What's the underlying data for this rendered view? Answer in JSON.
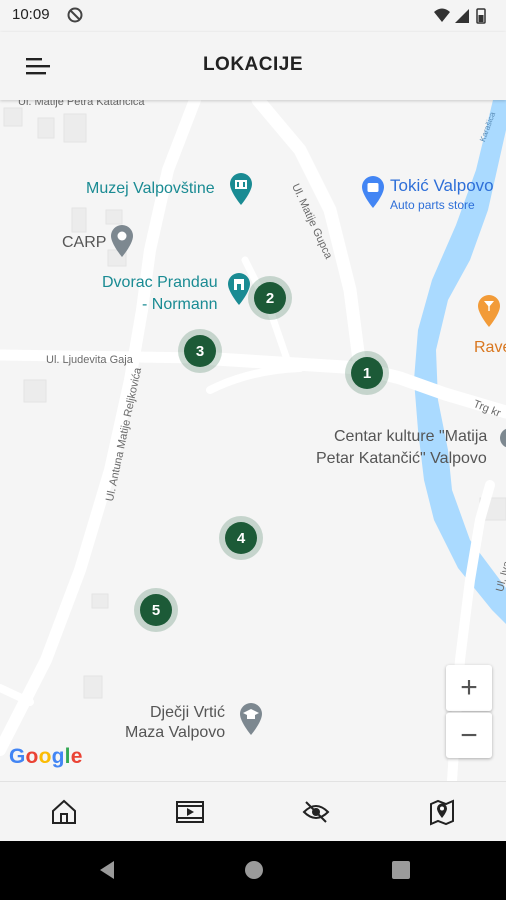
{
  "status_bar": {
    "time": "10:09"
  },
  "app_bar": {
    "title": "LOKACIJE"
  },
  "map": {
    "pois": {
      "museum": "Muzej Valpovštine",
      "carp": "CARP",
      "castle_line1": "Dvorac Prandau",
      "castle_line2": "- Normann",
      "store": "Tokić Valpovo",
      "store_sub": "Auto parts store",
      "rave": "Rave",
      "culture_line1": "Centar kulture \"Matija",
      "culture_line2": "Petar Katančić\" Valpovo",
      "kindergarten_line1": "Dječji Vrtić",
      "kindergarten_line2": "Maza Valpovo"
    },
    "streets": {
      "katancica": "Ul. Matije Petra Katančića",
      "gupca": "Ul. Matije Gupca",
      "gaja": "Ul. Ljudevita Gaja",
      "reljkovica": "Ul. Antuna Matije Reljkovića",
      "trg": "Trg kr",
      "karasica": "Karašica",
      "ivana": "Ul. Iva"
    },
    "markers": [
      "1",
      "2",
      "3",
      "4",
      "5"
    ],
    "zoom_in": "+",
    "zoom_out": "−",
    "attribution": {
      "G": "G",
      "o1": "o",
      "o2": "o",
      "g": "g",
      "l": "l",
      "e": "e"
    }
  },
  "bottom_nav": [
    "home-icon",
    "video-icon",
    "eye-off-icon",
    "map-pin-icon"
  ],
  "colors": {
    "marker": "#1c5a37",
    "water": "#aadaff",
    "teal_poi": "#1a8b93"
  }
}
